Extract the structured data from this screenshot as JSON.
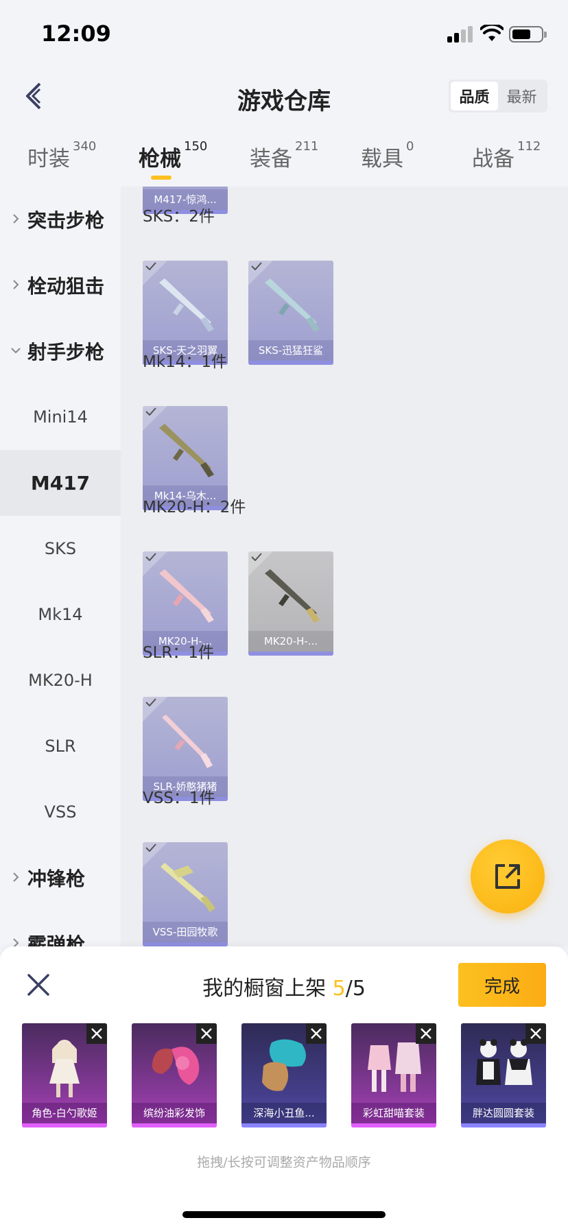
{
  "status": {
    "time": "12:09"
  },
  "header": {
    "title": "游戏仓库",
    "sort_quality": "品质",
    "sort_newest": "最新"
  },
  "tabs": [
    {
      "label": "时装",
      "count": "340"
    },
    {
      "label": "枪械",
      "count": "150"
    },
    {
      "label": "装备",
      "count": "211"
    },
    {
      "label": "载具",
      "count": "0"
    },
    {
      "label": "战备",
      "count": "112"
    }
  ],
  "sidebar": [
    {
      "label": "突击步枪",
      "kind": "group",
      "expanded": false
    },
    {
      "label": "栓动狙击",
      "kind": "group",
      "expanded": false
    },
    {
      "label": "射手步枪",
      "kind": "group",
      "expanded": true
    },
    {
      "label": "Mini14",
      "kind": "sub"
    },
    {
      "label": "M417",
      "kind": "sub",
      "active": true
    },
    {
      "label": "SKS",
      "kind": "sub"
    },
    {
      "label": "Mk14",
      "kind": "sub"
    },
    {
      "label": "MK20-H",
      "kind": "sub"
    },
    {
      "label": "SLR",
      "kind": "sub"
    },
    {
      "label": "VSS",
      "kind": "sub"
    },
    {
      "label": "冲锋枪",
      "kind": "group",
      "expanded": false
    },
    {
      "label": "霰弹枪",
      "kind": "group",
      "expanded": false
    }
  ],
  "main": {
    "partial_item": "M417-惊鸿...",
    "sections": [
      {
        "label": "SKS：2件",
        "items": [
          "SKS-天之羽翼",
          "SKS-迅猛狂鲨"
        ]
      },
      {
        "label": "Mk14：1件",
        "items": [
          "Mk14-乌木..."
        ]
      },
      {
        "label": "MK20-H：2件",
        "items": [
          "MK20-H-...",
          "MK20-H-..."
        ]
      },
      {
        "label": "SLR：1件",
        "items": [
          "SLR-娇憨猪猪"
        ]
      },
      {
        "label": "VSS：1件",
        "items": [
          "VSS-田园牧歌"
        ]
      }
    ]
  },
  "sheet": {
    "title_prefix": "我的橱窗上架",
    "count_current": "5",
    "count_total": "/5",
    "done_label": "完成",
    "items": [
      "角色-白勺歌姬",
      "缤纷油彩发饰",
      "深海小丑鱼...",
      "彩虹甜喵套装",
      "胖达圆圆套装"
    ],
    "hint": "拖拽/长按可调整资产物品顺序"
  },
  "colors": {
    "accent": "#fcc020",
    "card_purple": "#9e9ed0",
    "showcase_purple": "#8a3a9c"
  }
}
